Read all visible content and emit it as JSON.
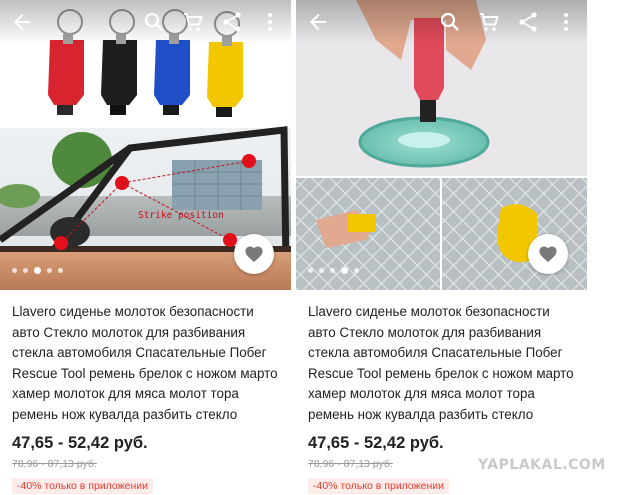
{
  "colors": {
    "accent_red": "#e63b2e",
    "promo_bg": "#fdecea",
    "tool_red": "#d8242f",
    "tool_blue": "#1f4fc7",
    "tool_yellow": "#f2c700",
    "tool_black": "#1e1e1e"
  },
  "left_card": {
    "photo_annotation": "Strike position",
    "title": "Llavero сиденье молоток безопасности авто Стекло молоток для разбивания стекла автомобиля Спасательные Побег Rescue Tool ремень брелок с ножом марто хамер молоток для мяса молот тора ремень нож кувалда разбить стекло",
    "price": "47,65 - 52,42 руб.",
    "old_price": "78,96 - 87,13 руб.",
    "promo": "-40% только в приложении",
    "carousel": {
      "total": 5,
      "active": 2
    }
  },
  "right_card": {
    "title": "Llavero сиденье молоток безопасности авто Стекло молоток для разбивания стекла автомобиля Спасательные Побег Rescue Tool ремень брелок с ножом марто хамер молоток для мяса молот тора ремень нож кувалда разбить стекло",
    "price": "47,65 - 52,42 руб.",
    "old_price": "78,96 - 87,13 руб.",
    "promo": "-40% только в приложении",
    "carousel": {
      "total": 5,
      "active": 3
    }
  },
  "icons": [
    "back-arrow-icon",
    "search-icon",
    "cart-icon",
    "share-icon",
    "more-vert-icon",
    "heart-icon"
  ],
  "watermark": "YAPLAKAL.COM"
}
